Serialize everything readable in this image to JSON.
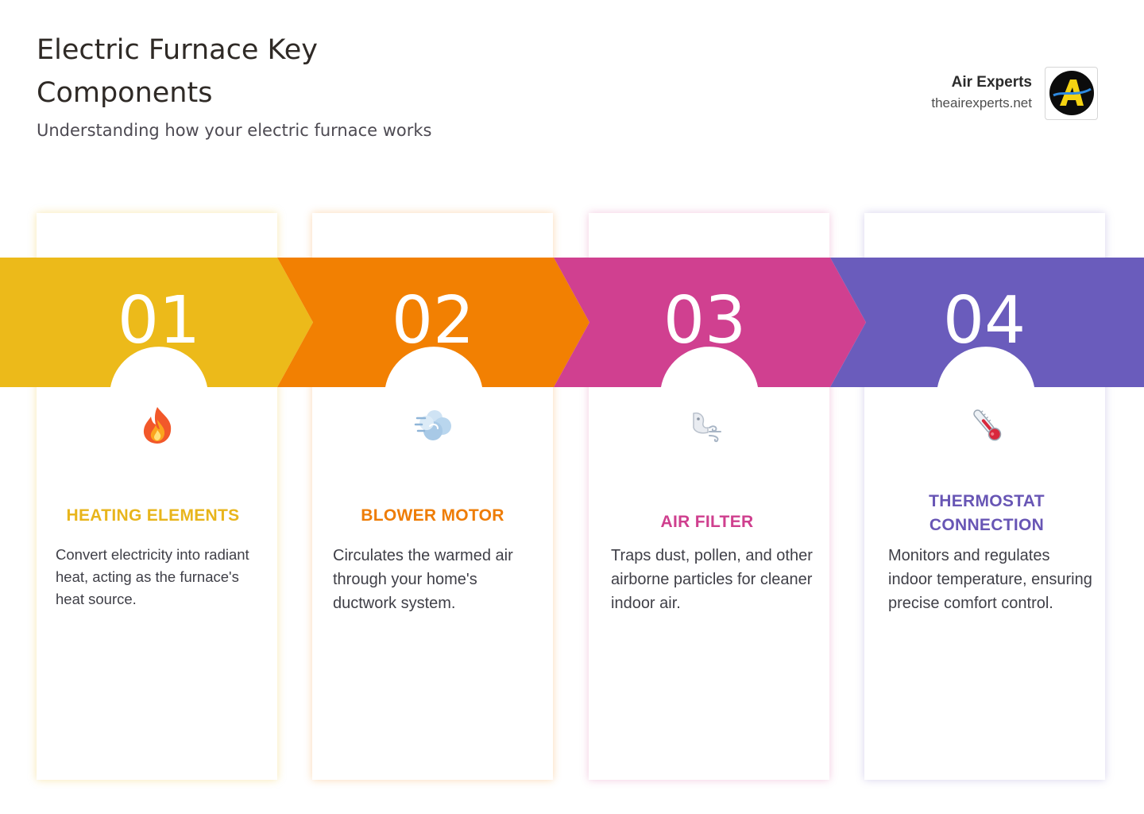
{
  "header": {
    "title": "Electric Furnace Key Components",
    "subtitle": "Understanding how your electric furnace works"
  },
  "brand": {
    "name": "Air Experts",
    "url": "theairexperts.net",
    "logo_icon": "air-experts-logo-icon"
  },
  "colors": {
    "yellow": "#ECBA1A",
    "orange": "#F28002",
    "pink": "#D04090",
    "purple": "#6A5CBC"
  },
  "steps": [
    {
      "number": "01",
      "icon": "fire-icon",
      "title": "HEATING ELEMENTS",
      "description": "Convert electricity into radiant heat, acting as the furnace's heat source."
    },
    {
      "number": "02",
      "icon": "wind-icon",
      "title": "BLOWER MOTOR",
      "description": "Circulates the warmed air through your home's ductwork system."
    },
    {
      "number": "03",
      "icon": "wind-face-icon",
      "title": "AIR FILTER",
      "description": "Traps dust, pollen, and other airborne particles for cleaner indoor air."
    },
    {
      "number": "04",
      "icon": "thermometer-icon",
      "title": "THERMOSTAT CONNECTION",
      "description": "Monitors and regulates indoor temperature, ensuring precise comfort control."
    }
  ]
}
